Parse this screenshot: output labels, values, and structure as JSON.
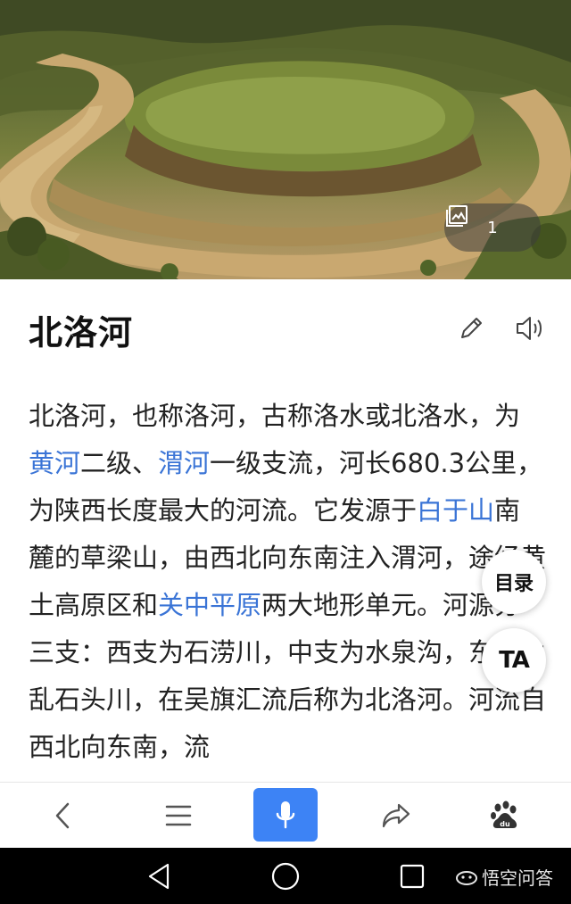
{
  "hero": {
    "photo_count": "1"
  },
  "article": {
    "title": "北洛河",
    "segments": [
      {
        "text": "北洛河，也称洛河，古称洛水或北洛水，为",
        "link": false
      },
      {
        "text": "黄河",
        "link": true
      },
      {
        "text": "二级、",
        "link": false
      },
      {
        "text": "渭河",
        "link": true
      },
      {
        "text": "一级支流，河长680.3公里，为陕西长度最大的河流。它发源于",
        "link": false
      },
      {
        "text": "白于山",
        "link": true
      },
      {
        "text": "南麓的草梁山，由西北向东南注入渭河，途经黄土高原区和",
        "link": false
      },
      {
        "text": "关中平原",
        "link": true
      },
      {
        "text": "两大地形单元。河源分三支：西支为石涝川，中支为水泉沟，东支为乱石头川，在吴旗汇流后称为北洛河。河流自西北向东南，流",
        "link": false
      }
    ]
  },
  "floating": {
    "toc_label": "目录",
    "text_size_label": "TA"
  },
  "toolbar": {
    "icons": [
      "back-icon",
      "menu-icon",
      "microphone-icon",
      "share-icon",
      "baidu-paw-icon"
    ],
    "accent_color": "#3d83f5"
  },
  "link_color": "#3a74d6",
  "watermark": {
    "text": "悟空问答"
  }
}
